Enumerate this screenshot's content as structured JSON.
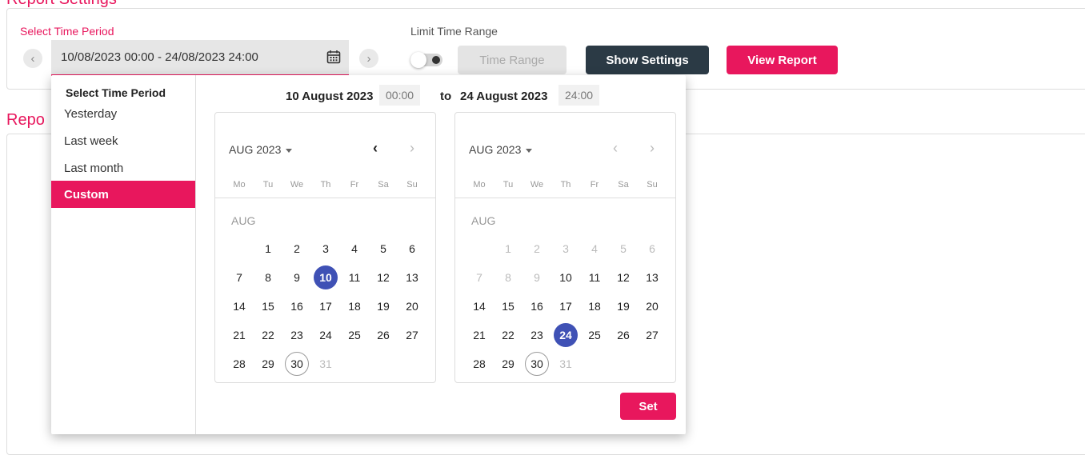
{
  "page": {
    "section1_title": "Report Settings",
    "section2_title": "Repo"
  },
  "filters": {
    "time_period_label": "Select Time Period",
    "time_period_value": "10/08/2023 00:00 - 24/08/2023 24:00",
    "limit_label": "Limit Time Range",
    "time_range_button": "Time Range",
    "show_settings_button": "Show Settings",
    "view_report_button": "View Report",
    "prev_symbol": "‹",
    "next_symbol": "›"
  },
  "picker": {
    "menu_title": "Select Time Period",
    "menu_items": [
      "Yesterday",
      "Last week",
      "Last month",
      "Custom"
    ],
    "active_item": "Custom",
    "start_date": "10 August 2023",
    "start_time": "00:00",
    "to_label": "to",
    "end_date": "24 August 2023",
    "end_time": "24:00",
    "set_button": "Set"
  },
  "calendars": [
    {
      "month_label": "AUG 2023",
      "month_tag": "AUG",
      "prev_arrow": "‹",
      "next_arrow": "›",
      "weekdays": [
        "Mo",
        "Tu",
        "We",
        "Th",
        "Fr",
        "Sa",
        "Su"
      ],
      "first_weekday": 1,
      "days_in_month": 31,
      "selected": 10,
      "today": 30,
      "muted_days": [
        31
      ]
    },
    {
      "month_label": "AUG 2023",
      "month_tag": "AUG",
      "prev_arrow": "‹",
      "next_arrow": "›",
      "weekdays": [
        "Mo",
        "Tu",
        "We",
        "Th",
        "Fr",
        "Sa",
        "Su"
      ],
      "first_weekday": 1,
      "days_in_month": 31,
      "selected": 24,
      "today": 30,
      "muted_days": [
        1,
        2,
        3,
        4,
        5,
        6,
        7,
        8,
        9,
        31
      ]
    }
  ],
  "colors": {
    "accent": "#e8175d",
    "selected_day": "#3f51b5",
    "dark_button": "#2b3a45"
  }
}
